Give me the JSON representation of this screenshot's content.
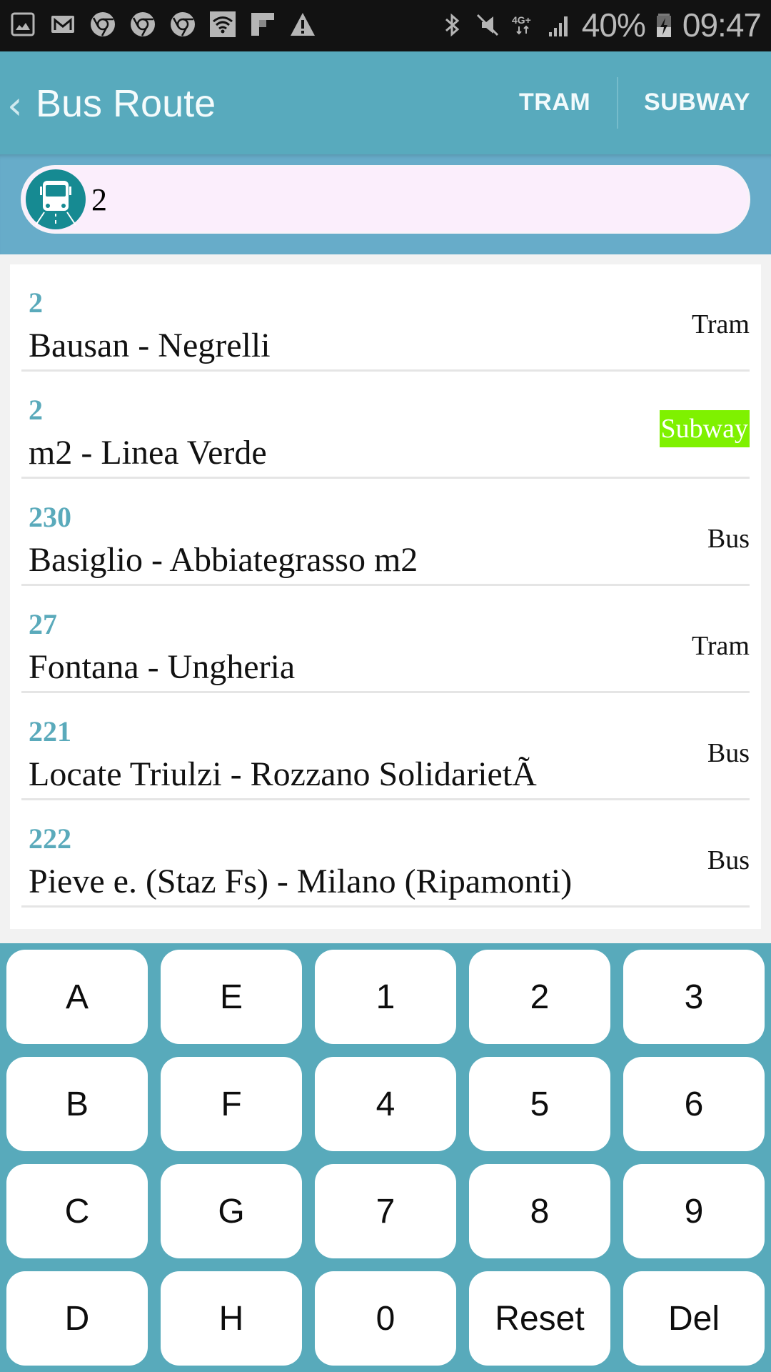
{
  "status_bar": {
    "left_icons": [
      "gallery-icon",
      "gmail-icon",
      "chrome-icon",
      "chrome-icon",
      "chrome-icon",
      "wifi-icon",
      "flipboard-icon",
      "warning-icon"
    ],
    "right_icons": [
      "bluetooth-icon",
      "mute-icon",
      "network-4g-plus-icon",
      "signal-icon"
    ],
    "battery": "40%",
    "time": "09:47"
  },
  "app_bar": {
    "back_glyph": "‹",
    "title": "Bus Route",
    "tabs": [
      {
        "label": "TRAM"
      },
      {
        "label": "SUBWAY"
      }
    ]
  },
  "search": {
    "icon": "bus-icon",
    "value": "2"
  },
  "routes": [
    {
      "number": "2",
      "name": "Bausan - Negrelli",
      "type": "Tram",
      "highlight": false
    },
    {
      "number": "2",
      "name": "m2 - Linea Verde",
      "type": "Subway",
      "highlight": true
    },
    {
      "number": "230",
      "name": "Basiglio - Abbiategrasso m2",
      "type": "Bus",
      "highlight": false
    },
    {
      "number": "27",
      "name": "Fontana - Ungheria",
      "type": "Tram",
      "highlight": false
    },
    {
      "number": "221",
      "name": "Locate Triulzi - Rozzano SolidarietÃ",
      "type": "Bus",
      "highlight": false
    },
    {
      "number": "222",
      "name": "Pieve e. (Staz Fs) - Milano (Ripamonti)",
      "type": "Bus",
      "highlight": false
    }
  ],
  "keypad": {
    "rows": [
      [
        "A",
        "E",
        "1",
        "2",
        "3"
      ],
      [
        "B",
        "F",
        "4",
        "5",
        "6"
      ],
      [
        "C",
        "G",
        "7",
        "8",
        "9"
      ],
      [
        "D",
        "H",
        "0",
        "Reset",
        "Del"
      ]
    ]
  },
  "colors": {
    "primary": "#58aabd",
    "accent_text": "#5aaabb",
    "subway_badge": "#7ff100",
    "search_bg": "#fbeefc",
    "bus_badge": "#168a92"
  }
}
